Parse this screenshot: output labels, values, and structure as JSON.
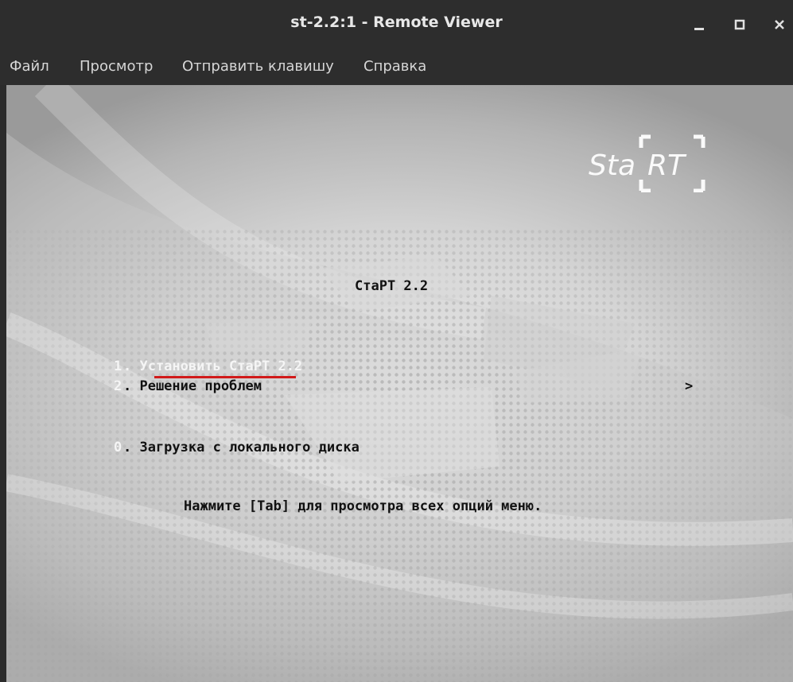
{
  "window": {
    "title": "st-2.2:1 - Remote Viewer",
    "controls": {
      "minimize": "_",
      "maximize": "□",
      "close": "✕"
    }
  },
  "menubar": {
    "items": [
      "Файл",
      "Просмотр",
      "Отправить клавишу",
      "Справка"
    ]
  },
  "boot": {
    "heading": "СтаРТ 2.2",
    "options": [
      {
        "number": "1",
        "label": ". Установить СтаРТ 2.2",
        "arrow": "",
        "selected": true
      },
      {
        "number": "2",
        "label": ". Решение проблем",
        "arrow": ">",
        "selected": false
      },
      {
        "number": "0",
        "label": ". Загрузка с локального диска",
        "arrow": "",
        "selected": false
      }
    ],
    "hint": "Нажмите [Tab] для просмотра всех опций меню."
  },
  "logo": {
    "left": "Sta",
    "right": "RT"
  },
  "colors": {
    "titlebar": "#2d2d2d",
    "underline": "#d11a1a",
    "menu_text": "#d6d6d6"
  }
}
